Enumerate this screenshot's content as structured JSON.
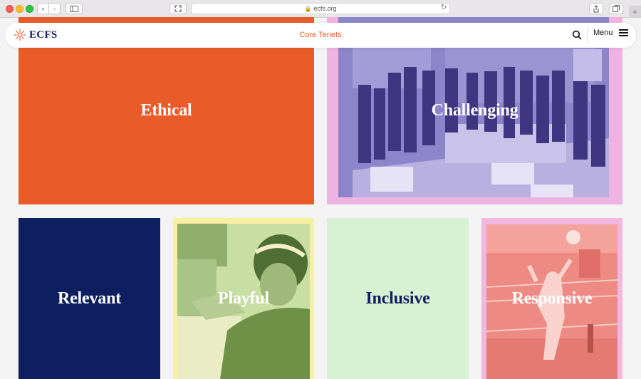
{
  "browser": {
    "url": "ecfs.org"
  },
  "header": {
    "logo_text": "ECFS",
    "page_label": "Core Tenets",
    "menu_label": "Menu"
  },
  "tiles": [
    {
      "label": "Ethical",
      "color": "#ea5b2a"
    },
    {
      "label": "Challenging",
      "color": "#efb3e2"
    },
    {
      "label": "Relevant",
      "color": "#0e1f60"
    },
    {
      "label": "Playful",
      "color": "#f7f0a2"
    },
    {
      "label": "Inclusive",
      "color": "#d7f1d3"
    },
    {
      "label": "Responsive",
      "color": "#f3b6df"
    }
  ],
  "colors": {
    "accent": "#ea5b2a",
    "navy": "#0e1e5b"
  }
}
